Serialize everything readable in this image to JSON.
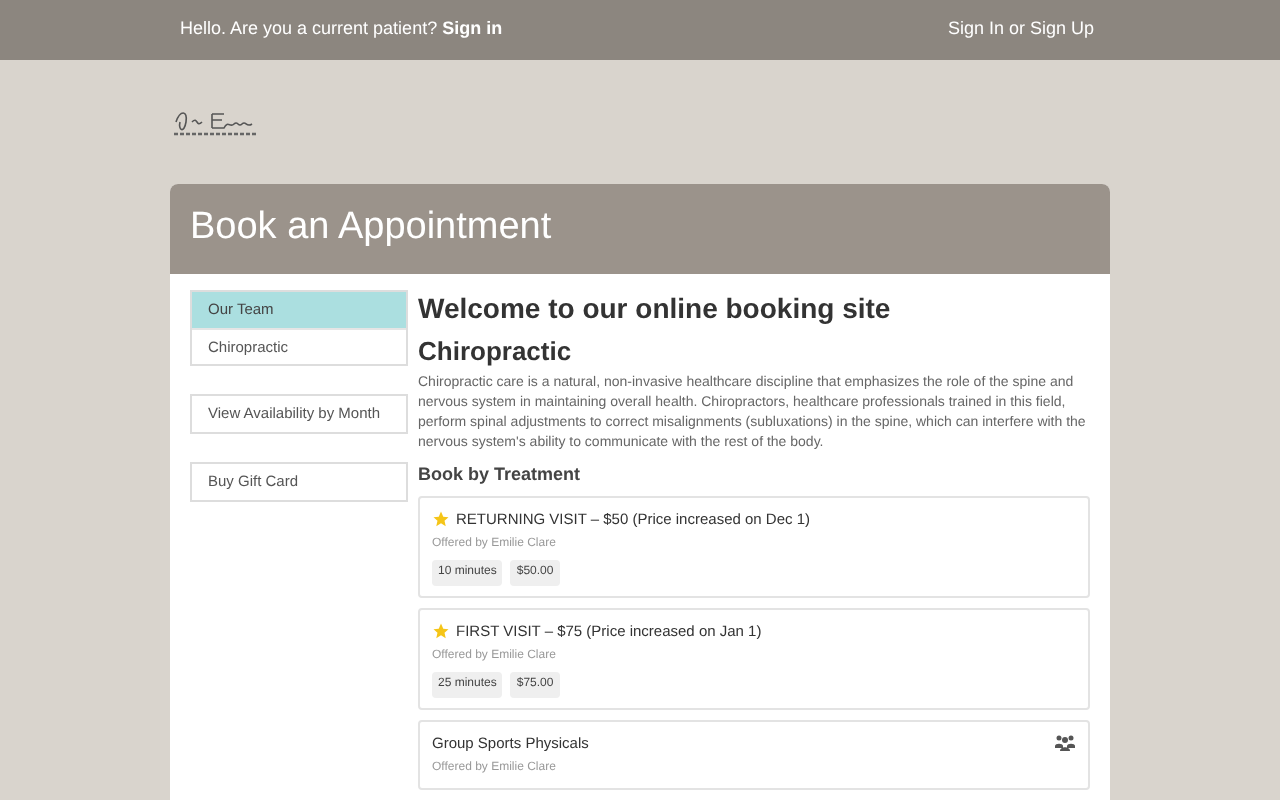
{
  "top_bar": {
    "greeting": "Hello. Are you a current patient?",
    "greeting_link": "Sign in",
    "right_link": "Sign In or Sign Up"
  },
  "card": {
    "title": "Book an Appointment"
  },
  "sidebar": {
    "groups": [
      [
        {
          "label": "Our Team",
          "selected": true
        },
        {
          "label": "Chiropractic",
          "selected": false
        }
      ],
      [
        {
          "label": "View Availability by Month",
          "selected": false
        }
      ],
      [
        {
          "label": "Buy Gift Card",
          "selected": false
        }
      ]
    ]
  },
  "main": {
    "heading": "Welcome to our online booking site",
    "subheading": "Chiropractic",
    "description": "Chiropractic care is a natural, non-invasive healthcare discipline that emphasizes the role of the spine and nervous system in maintaining overall health. Chiropractors, healthcare professionals trained in this field, perform spinal adjustments to correct misalignments (subluxations) in the spine, which can interfere with the nervous system's ability to communicate with the rest of the body.",
    "section_title": "Book by Treatment",
    "treatments": [
      {
        "kind": "featured",
        "name": "RETURNING VISIT – $50 (Price increased on Dec 1)",
        "offered_by": "Offered by Emilie Clare",
        "tags": [
          "10 minutes",
          "$50.00"
        ]
      },
      {
        "kind": "featured",
        "name": "FIRST VISIT – $75 (Price increased on Jan 1)",
        "offered_by": "Offered by Emilie Clare",
        "tags": [
          "25 minutes",
          "$75.00"
        ]
      },
      {
        "kind": "group",
        "name": "Group Sports Physicals",
        "offered_by": "Offered by Emilie Clare"
      }
    ]
  }
}
